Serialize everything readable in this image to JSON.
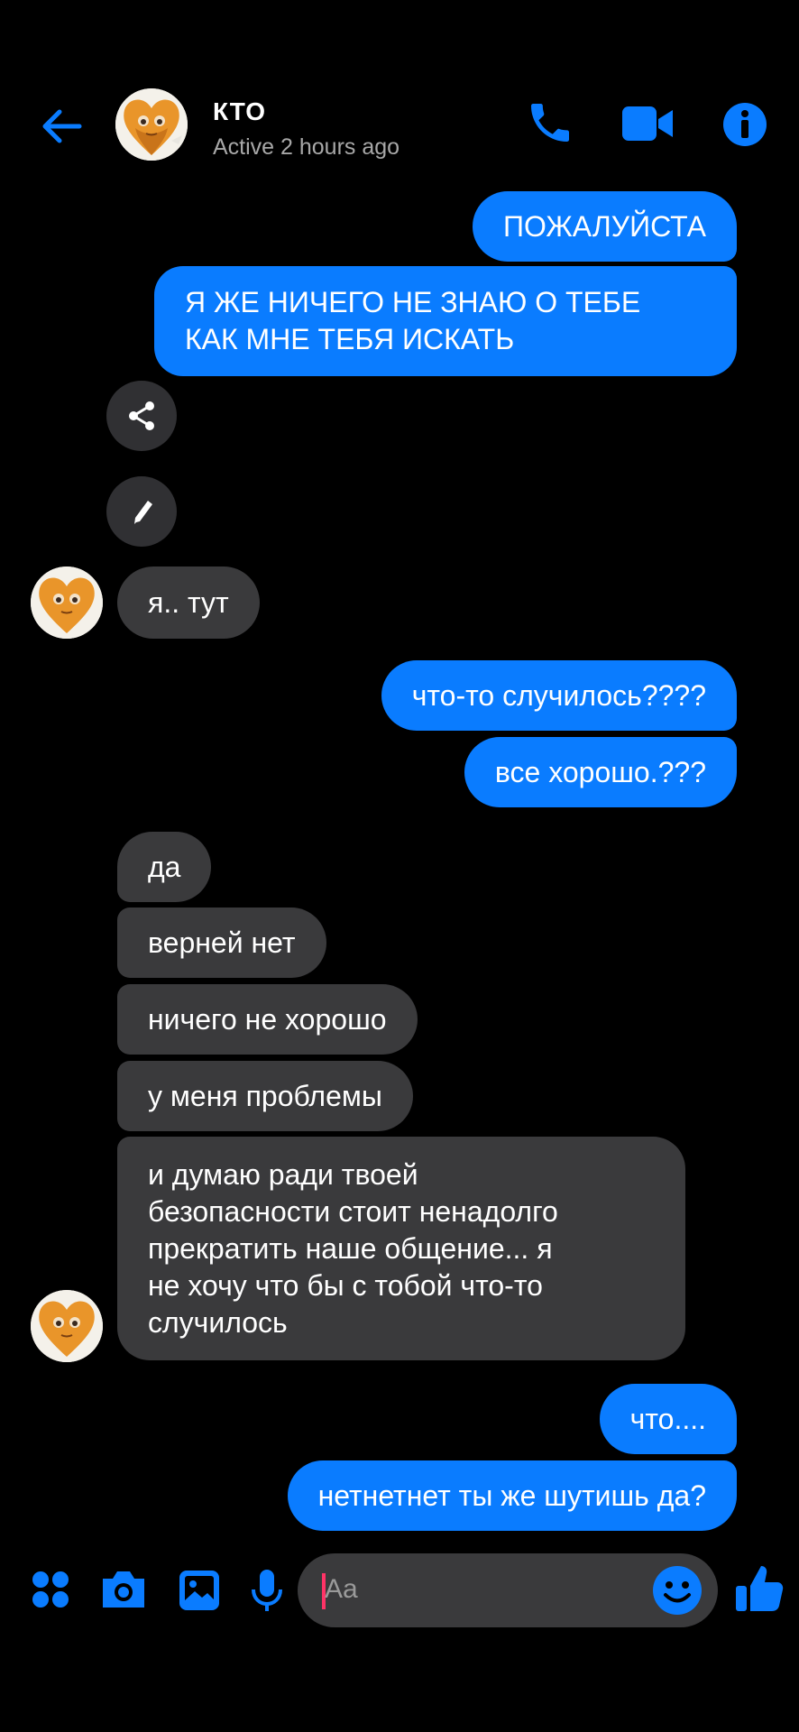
{
  "header": {
    "contact_name": "КТО",
    "status": "Active 2 hours ago",
    "icons": [
      "back-arrow-icon",
      "phone-icon",
      "video-camera-icon",
      "info-icon"
    ]
  },
  "colors": {
    "accent": "#0a7cff",
    "incoming": "#3a3a3c",
    "background": "#000000"
  },
  "messages": [
    {
      "direction": "outgoing",
      "text": "ПОЖАЛУЙСТА"
    },
    {
      "direction": "outgoing",
      "text": "Я ЖЕ НИЧЕГО НЕ ЗНАЮ О ТЕБЕ\nКАК МНЕ ТЕБЯ ИСКАТЬ"
    },
    {
      "direction": "incoming",
      "text": "я.. тут"
    },
    {
      "direction": "outgoing",
      "text": "что-то случилось????"
    },
    {
      "direction": "outgoing",
      "text": "все хорошо.???"
    },
    {
      "direction": "incoming",
      "text": "да"
    },
    {
      "direction": "incoming",
      "text": "верней нет"
    },
    {
      "direction": "incoming",
      "text": "ничего не хорошо"
    },
    {
      "direction": "incoming",
      "text": "у меня проблемы"
    },
    {
      "direction": "incoming",
      "text": "и думаю ради твоей\nбезопасности стоит ненадолго\nпрекратить наше общение... я\nне хочу что бы с тобой что-то\nслучилось"
    },
    {
      "direction": "outgoing",
      "text": "что...."
    },
    {
      "direction": "outgoing",
      "text": "нетнетнет ты же шутишь да?"
    }
  ],
  "message_actions": [
    "share-icon",
    "edit-pencil-icon"
  ],
  "composer": {
    "placeholder": "Aa",
    "icons": [
      "apps-grid-icon",
      "camera-icon",
      "gallery-image-icon",
      "microphone-icon",
      "emoji-icon",
      "thumbs-up-icon"
    ]
  }
}
